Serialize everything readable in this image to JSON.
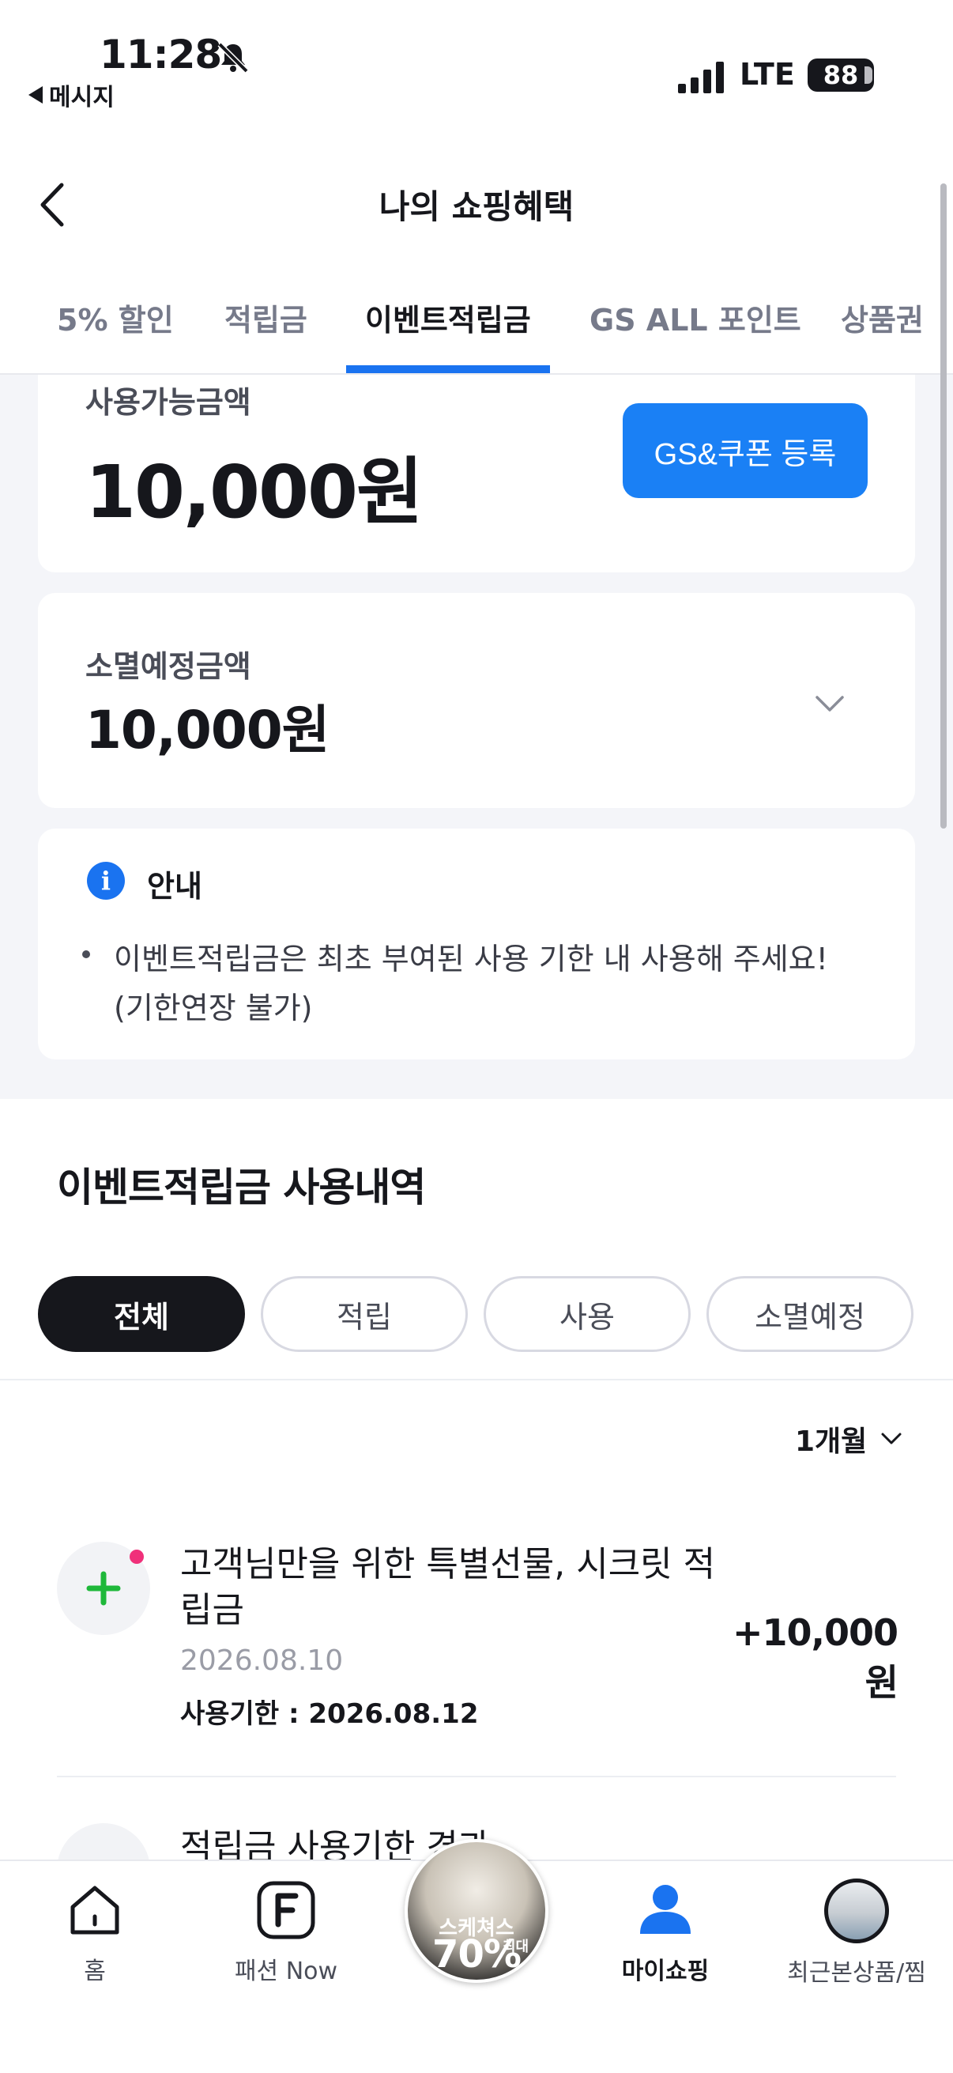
{
  "status": {
    "time": "11:28",
    "back_app": "메시지",
    "network": "LTE",
    "battery": "88"
  },
  "header": {
    "title": "나의 쇼핑혜택"
  },
  "tabs": [
    {
      "label": "5% 할인"
    },
    {
      "label": "적립금"
    },
    {
      "label": "이벤트적립금"
    },
    {
      "label": "GS ALL 포인트"
    },
    {
      "label": "상품권"
    }
  ],
  "available": {
    "label": "사용가능금액",
    "amount": "10,000원",
    "coupon_button": "GS&쿠폰 등록"
  },
  "expiring": {
    "label": "소멸예정금액",
    "amount": "10,000원"
  },
  "notice": {
    "title": "안내",
    "text": "이벤트적립금은 최초 부여된 사용 기한 내 사용해 주세요! (기한연장 불가)"
  },
  "history": {
    "title": "이벤트적립금 사용내역",
    "filters": [
      {
        "label": "전체"
      },
      {
        "label": "적립"
      },
      {
        "label": "사용"
      },
      {
        "label": "소멸예정"
      }
    ],
    "period": "1개월",
    "items": [
      {
        "title": "고객님만을 위한 특별선물, 시크릿 적립금",
        "date": "2026.08.10",
        "deadline": "사용기한 : 2026.08.12",
        "amount": "+10,000원"
      },
      {
        "title": "적립금 사용기한 경과"
      }
    ]
  },
  "bottom_nav": {
    "home": "홈",
    "fashion": "패션 Now",
    "promo_brand": "스케쳐스",
    "promo_max": "최대",
    "promo_percent": "70%",
    "myshopping": "마이쇼핑",
    "recent": "최근본상품/찜"
  },
  "colors": {
    "accent": "#1a73f0",
    "button": "#1a80f5",
    "plus": "#1fb83a",
    "dot": "#f0307a",
    "dark": "#16171c"
  }
}
